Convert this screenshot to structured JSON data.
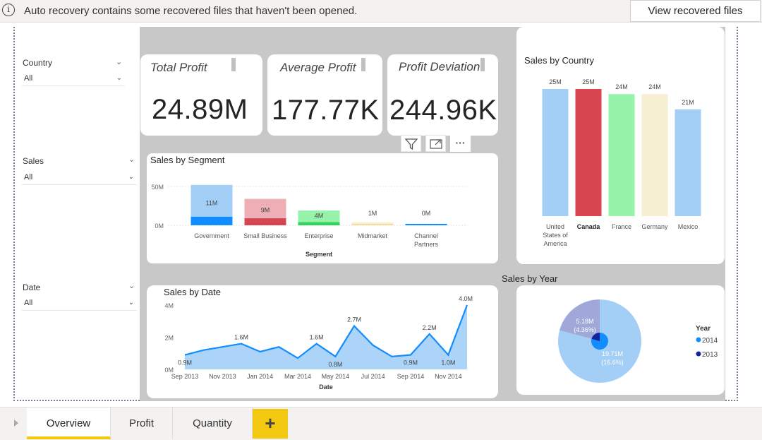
{
  "notification": {
    "message": "Auto recovery contains some recovered files that haven't been opened.",
    "button": "View recovered files"
  },
  "slicers": [
    {
      "label": "Country",
      "value": "All"
    },
    {
      "label": "Sales",
      "value": "All"
    },
    {
      "label": "Date",
      "value": "All"
    }
  ],
  "kpis": [
    {
      "title": "Total Profit",
      "value": "24.89M"
    },
    {
      "title": "Average Profit",
      "value": "177.77K"
    },
    {
      "title": "Profit Deviation",
      "value": "244.96K"
    }
  ],
  "visual_toolbar": {
    "filter_icon": "filter-icon",
    "focus_icon": "focus-mode-icon",
    "more_icon": "more-options-icon",
    "more_label": "···"
  },
  "tabs": [
    {
      "label": "Overview",
      "active": true
    },
    {
      "label": "Profit",
      "active": false
    },
    {
      "label": "Quantity",
      "active": false
    }
  ],
  "add_tab_label": "+",
  "colors": {
    "accent": "#f2c811",
    "light_blue": "#a3cff7",
    "blue": "#118dff",
    "red": "#d64550",
    "green": "#95f4a9",
    "cream": "#f7efd2",
    "dark_navy": "#12239e"
  },
  "chart_data": [
    {
      "id": "sales_by_segment",
      "type": "bar",
      "title": "Sales by Segment",
      "xlabel": "Segment",
      "ylabel": "",
      "y_ticks": [
        "50M",
        "0M"
      ],
      "ylim": [
        0,
        50
      ],
      "categories": [
        "Government",
        "Small Business",
        "Enterprise",
        "Midmarket",
        "Channel Partners"
      ],
      "category_lines": [
        [
          "Government"
        ],
        [
          "Small Business"
        ],
        [
          "Enterprise"
        ],
        [
          "Midmarket"
        ],
        [
          "Channel",
          "Partners"
        ]
      ],
      "values": [
        11,
        9,
        4,
        1,
        0
      ],
      "value_labels": [
        "11M",
        "9M",
        "4M",
        "1M",
        "0M"
      ],
      "totals": [
        52,
        34,
        19,
        4,
        2
      ],
      "colors": [
        "#a3cff7",
        "#eeb0b6",
        "#95f4a9",
        "#f7efd2",
        "#a3cff7"
      ],
      "base_colors": [
        "#118dff",
        "#d64550",
        "#2fd35a",
        "#f0dfa0",
        "#118dff"
      ]
    },
    {
      "id": "sales_by_country",
      "type": "bar",
      "title": "Sales by Country",
      "categories": [
        "United States of America",
        "Canada",
        "France",
        "Germany",
        "Mexico"
      ],
      "category_lines": [
        [
          "United",
          "States of",
          "America"
        ],
        [
          "Canada"
        ],
        [
          "France"
        ],
        [
          "Germany"
        ],
        [
          "Mexico"
        ]
      ],
      "values": [
        25,
        25,
        24,
        24,
        21
      ],
      "value_labels": [
        "25M",
        "25M",
        "24M",
        "24M",
        "21M"
      ],
      "highlighted": "Canada",
      "colors": [
        "#a3cff7",
        "#d64550",
        "#95f4a9",
        "#f7efd2",
        "#a3cff7"
      ]
    },
    {
      "id": "sales_by_date",
      "type": "area",
      "title": "Sales by Date",
      "xlabel": "Date",
      "y_ticks": [
        "4M",
        "2M",
        "0M"
      ],
      "ylim": [
        0,
        4
      ],
      "x_ticks": [
        "Sep 2013",
        "Nov 2013",
        "Jan 2014",
        "Mar 2014",
        "May 2014",
        "Jul 2014",
        "Sep 2014",
        "Nov 2014"
      ],
      "x": [
        "Sep 2013",
        "Oct 2013",
        "Nov 2013",
        "Dec 2013",
        "Jan 2014",
        "Feb 2014",
        "Mar 2014",
        "Apr 2014",
        "May 2014",
        "Jun 2014",
        "Jul 2014",
        "Aug 2014",
        "Sep 2014",
        "Oct 2014",
        "Nov 2014",
        "Dec 2014"
      ],
      "values": [
        0.9,
        1.2,
        1.4,
        1.6,
        1.1,
        1.4,
        0.7,
        1.6,
        0.8,
        2.7,
        1.5,
        0.8,
        0.9,
        2.2,
        0.9,
        4.0
      ],
      "point_labels": {
        "0": "0.9M",
        "3": "1.6M",
        "7": "1.6M",
        "8": "0.8M",
        "9": "2.7M",
        "12": "0.9M",
        "13": "2.2M",
        "14": "1.0M",
        "15": "4.0M"
      },
      "color": "#118dff"
    },
    {
      "id": "sales_by_year",
      "type": "pie",
      "title": "Sales by Year",
      "legend_title": "Year",
      "legend": [
        {
          "name": "2014",
          "color": "#118dff"
        },
        {
          "name": "2013",
          "color": "#12239e"
        }
      ],
      "slices": [
        {
          "name": "2014",
          "value": 19.71,
          "label": "19.71M",
          "pct": "(16.6%)",
          "color": "#a3cff7"
        },
        {
          "name": "2013",
          "value": 5.18,
          "label": "5.18M",
          "pct": "(4.36%)",
          "color": "#9fa8d8"
        }
      ]
    }
  ]
}
